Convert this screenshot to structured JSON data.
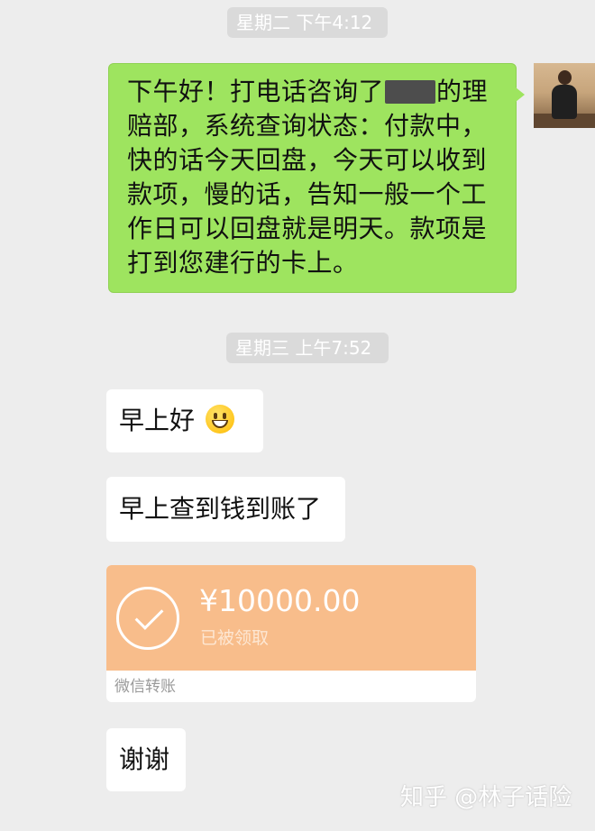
{
  "chat": {
    "timestamp_1": "星期二 下午4:12",
    "timestamp_2": "星期三 上午7:52",
    "sent_message": {
      "lines": [
        [
          "下午好！打电话咨询了",
          "的理"
        ],
        "赔部，系统查询状态：付款中，",
        "快的话今天回盘，今天可以收到",
        "款项，慢的话，告知一般一个工",
        "作日可以回盘就是明天。款项是",
        "打到您建行的卡上。"
      ],
      "redacted": true
    },
    "received_messages": [
      {
        "text": "早上好",
        "emoji": "grinning-face-emoji"
      },
      {
        "text": "早上查到钱到账了"
      },
      {
        "text": "谢谢"
      }
    ],
    "transfer": {
      "amount": "¥10000.00",
      "status": "已被领取",
      "label": "微信转账",
      "icon": "checkmark-circle-icon"
    }
  },
  "watermark": "知乎 @林子话险",
  "colors": {
    "background": "#ededed",
    "sent_bubble": "#9ee45f",
    "received_bubble": "#ffffff",
    "transfer_card": "#f8bd8b",
    "timestamp_bg": "#dadada"
  }
}
